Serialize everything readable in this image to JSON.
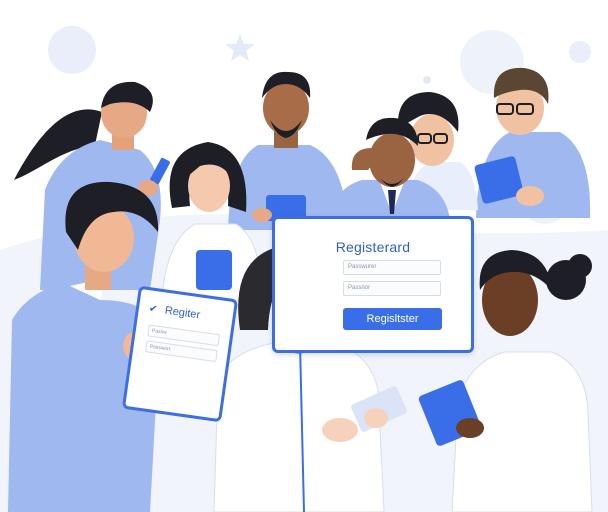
{
  "main_card": {
    "title": "Registerard",
    "field_1_placeholder": "Passwurer",
    "field_2_placeholder": "Passnor",
    "button_label": "Regisltster"
  },
  "left_card": {
    "title": "Regiter",
    "field_1_placeholder": "Passw",
    "field_2_placeholder": "Passwort",
    "check_icon": "checkmark-icon"
  },
  "colors": {
    "accent": "#3a6ee8",
    "card_border": "#3d6fe0",
    "sweater_blue": "#9fb8ef",
    "hair_dark": "#1e1f26",
    "background_tint": "#eef2fb"
  }
}
